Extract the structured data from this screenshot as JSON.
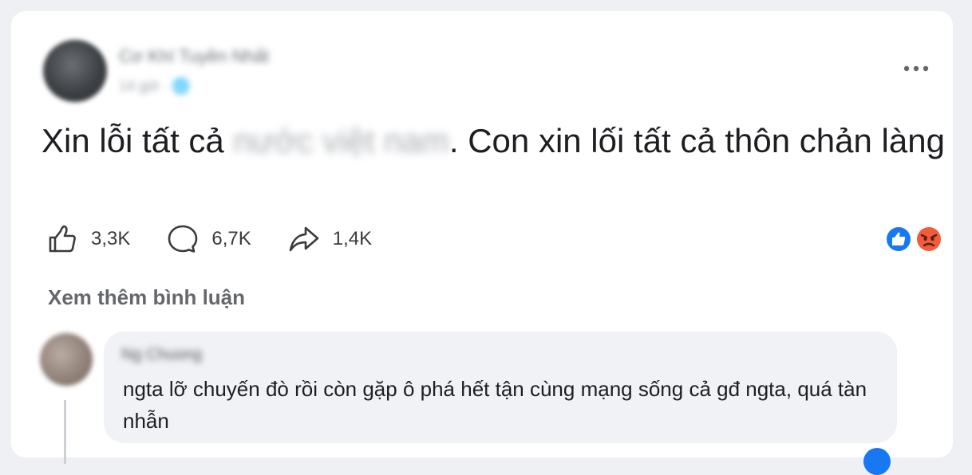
{
  "post": {
    "author": {
      "name": "Cơ Khí Tuyền Nhất",
      "meta": "14 giờ · 🌐"
    },
    "text": {
      "part1": "Xin lỗi tất cả",
      "redacted": "nước việt nam",
      "part2": ". Con xin lối tất cả thôn chản làng"
    },
    "actions": {
      "like_count": "3,3K",
      "comment_count": "6,7K",
      "share_count": "1,4K"
    },
    "reactions": [
      "like-icon",
      "angry-icon"
    ],
    "colors": {
      "like_blue": "#1877f2",
      "angry_orange": "#f25c3b",
      "text": "#1c1e21",
      "muted": "#65676b"
    }
  },
  "comments": {
    "see_more_label": "Xem thêm bình luận",
    "items": [
      {
        "author": "Ng Chuong",
        "text": "ngta lỡ chuyến đò rồi còn gặp ô phá hết tận cùng mạng sống cả gđ ngta, quá tàn nhẫn"
      }
    ]
  }
}
